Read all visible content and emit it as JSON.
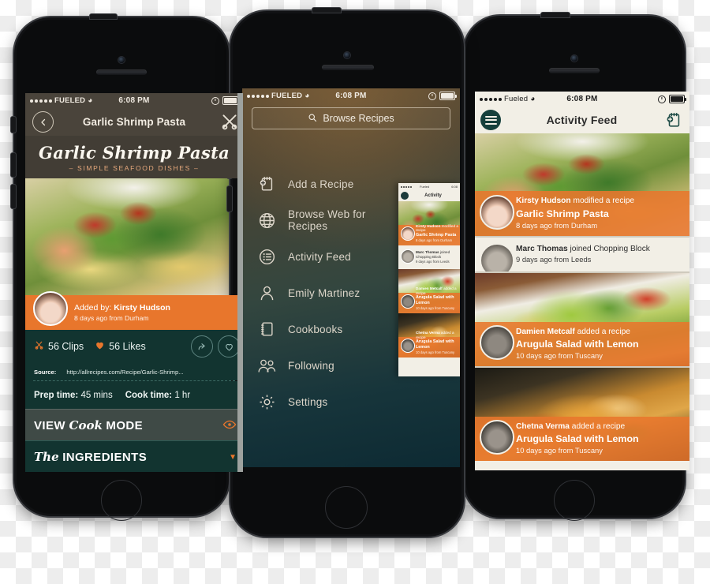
{
  "scene": {
    "description": "Three iPhone mockups showing a recipe app"
  },
  "phones": {
    "left": {
      "name": "recipe-detail-screen",
      "status_bar": {
        "carrier": "FUELED",
        "time": "6:08 PM",
        "wifi_icon": "wifi-icon",
        "lock_icon": "rotation-lock-icon",
        "battery_icon": "battery-icon"
      },
      "nav": {
        "back_icon": "back-chevron-icon",
        "title": "Garlic Shrimp Pasta",
        "util_icon": "utensils-icon"
      },
      "banner": {
        "title": "Garlic Shrimp Pasta",
        "subtitle": "– SIMPLE SEAFOOD DISHES –"
      },
      "added_by": {
        "prefix": "Added by: ",
        "user": "Kirsty Hudson",
        "meta": "8 days ago from Durham",
        "avatar_icon": "avatar"
      },
      "stats": {
        "clips_icon": "scissors-icon",
        "clips": "56 Clips",
        "likes_icon": "heart-icon",
        "likes": "56 Likes",
        "share_icon": "share-arrow-icon",
        "favorite_icon": "heart-outline-icon"
      },
      "source": {
        "label": "Source: ",
        "url": "http://allrecipes.com/Recipe/Garlic-Shrimp..."
      },
      "times": {
        "prep_label": "Prep time: ",
        "prep_value": "45 mins",
        "cook_label": "Cook time: ",
        "cook_value": "1 hr"
      },
      "cook_mode": {
        "pre": "VIEW ",
        "script": "Cook",
        "post": " MODE",
        "eye_icon": "eye-icon"
      },
      "ingredients": {
        "script": "The",
        "post": " INGREDIENTS",
        "chevron_icon": "chevron-down-icon"
      }
    },
    "middle": {
      "name": "side-menu-screen",
      "status_bar": {
        "carrier": "FUELED",
        "time": "6:08 PM",
        "wifi_icon": "wifi-icon",
        "lock_icon": "rotation-lock-icon",
        "battery_icon": "battery-icon"
      },
      "search": {
        "icon": "search-icon",
        "placeholder": "Browse Recipes"
      },
      "menu_items": [
        {
          "label": "Add a Recipe",
          "icon": "add-recipe-icon"
        },
        {
          "label": "Browse Web for Recipes",
          "icon": "globe-icon"
        },
        {
          "label": "Activity Feed",
          "icon": "list-circle-icon"
        },
        {
          "label": "Emily Martinez",
          "icon": "user-icon"
        },
        {
          "label": "Cookbooks",
          "icon": "notebook-icon"
        },
        {
          "label": "Following",
          "icon": "users-icon"
        },
        {
          "label": "Settings",
          "icon": "gear-icon"
        }
      ],
      "preview": {
        "status_carrier": "Fueled",
        "status_time": "6:08",
        "nav_title": "Activity",
        "cards": [
          {
            "line1_user": "Kirsty Hudson",
            "line1_action": " modified a recipe",
            "line2": "Garlic Shrimp Pasta",
            "line3": "8 days ago from Durham",
            "style": "orange",
            "image": "pasta"
          },
          {
            "line1_user": "Marc Thomas",
            "line1_action": " joined Chopping Block",
            "line2": "",
            "line3": "9 days ago from Leeds",
            "style": "light",
            "image": "none"
          },
          {
            "line1_user": "Damien Metcalf",
            "line1_action": " added a recipe",
            "line2": "Arugula Salad with Lemon",
            "line3": "10 days ago from Tuscany",
            "style": "orange",
            "image": "arugula"
          },
          {
            "line1_user": "Chetna Verma",
            "line1_action": " added a recipe",
            "line2": "Arugula Salad with Lemon",
            "line3": "10 days ago from Tuscany",
            "style": "orange",
            "image": "curry"
          }
        ]
      }
    },
    "right": {
      "name": "activity-feed-screen",
      "status_bar": {
        "carrier": "Fueled",
        "time": "6:08 PM",
        "wifi_icon": "wifi-icon",
        "lock_icon": "rotation-lock-icon",
        "battery_icon": "battery-icon"
      },
      "nav": {
        "menu_icon": "hamburger-menu-icon",
        "title": "Activity Feed",
        "add_icon": "add-recipe-icon"
      },
      "feed": [
        {
          "user": "Kirsty Hudson",
          "action": " modified a recipe",
          "recipe": "Garlic Shrimp Pasta",
          "meta": "8 days ago from Durham",
          "style": "orange",
          "image": "pasta",
          "avatar_icon": "avatar"
        },
        {
          "user": "Marc Thomas",
          "action": " joined Chopping Block",
          "recipe": "",
          "meta": "9 days ago from Leeds",
          "style": "light",
          "image": "none",
          "avatar_icon": "avatar"
        },
        {
          "user": "Damien Metcalf",
          "action": " added a recipe",
          "recipe": "Arugula Salad with Lemon",
          "meta": "10 days ago from Tuscany",
          "style": "orange",
          "image": "arugula",
          "avatar_icon": "avatar"
        },
        {
          "user": "Chetna Verma",
          "action": " added a recipe",
          "recipe": "Arugula Salad with Lemon",
          "meta": "10 days ago from Tuscany",
          "style": "orange",
          "image": "curry",
          "avatar_icon": "avatar"
        }
      ]
    }
  },
  "colors": {
    "accent_orange": "#e8762c",
    "dark_teal": "#123430",
    "nav_brown": "#4a443b",
    "cream": "#f2efe6"
  }
}
